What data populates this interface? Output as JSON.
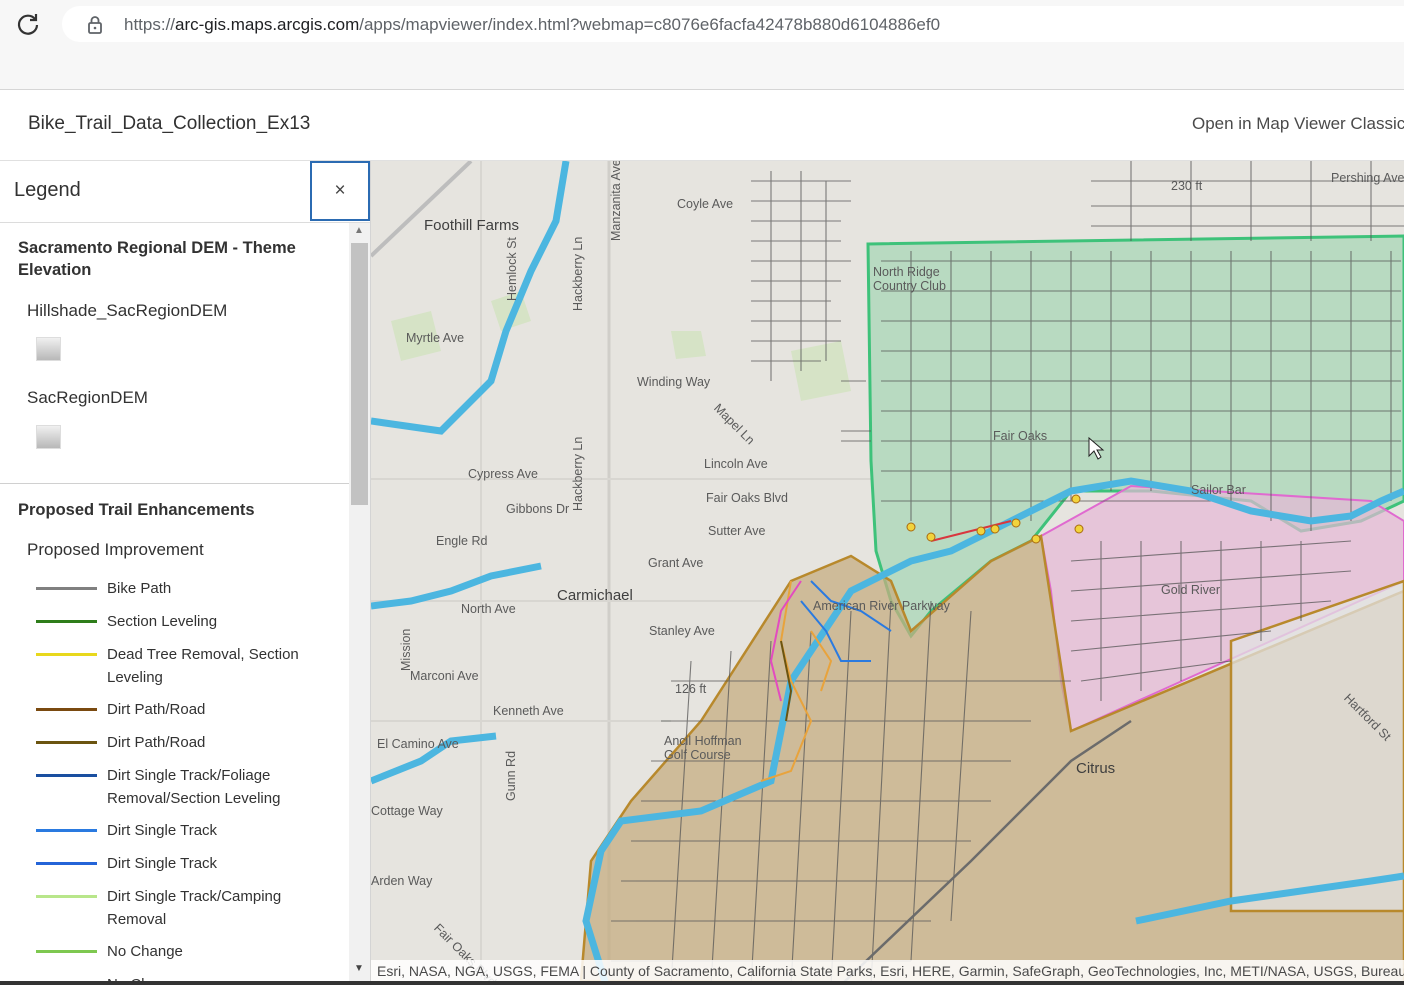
{
  "browser": {
    "url_prefix": "https://",
    "url_host": "arc-gis.maps.arcgis.com",
    "url_path": "/apps/mapviewer/index.html?webmap=c8076e6facfa42478b880d6104886ef0"
  },
  "header": {
    "title": "Bike_Trail_Data_Collection_Ex13",
    "open_classic": "Open in Map Viewer Classic"
  },
  "legend": {
    "title": "Legend",
    "close_label": "×",
    "layers": [
      {
        "title": "Sacramento Regional DEM - Theme Elevation",
        "sublayers": [
          "Hillshade_SacRegionDEM",
          "SacRegionDEM"
        ]
      },
      {
        "title": "Proposed Trail Enhancements",
        "field": "Proposed Improvement",
        "items": [
          {
            "label": "Bike Path",
            "color": "#808080"
          },
          {
            "label": "Section Leveling",
            "color": "#2e7d1a"
          },
          {
            "label": "Dead Tree Removal, Section Leveling",
            "color": "#e8d81c"
          },
          {
            "label": "Dirt Path/Road",
            "color": "#7a4a10"
          },
          {
            "label": "Dirt Path/Road",
            "color": "#6b5410"
          },
          {
            "label": "Dirt Single Track/Foliage Removal/Section Leveling",
            "color": "#1a4fa0"
          },
          {
            "label": "Dirt Single Track",
            "color": "#2a7ae0"
          },
          {
            "label": "Dirt Single Track",
            "color": "#2464d8"
          },
          {
            "label": "Dirt Single Track/Camping Removal",
            "color": "#b8e68a"
          },
          {
            "label": "No Change",
            "color": "#7ec850"
          },
          {
            "label": "No Change",
            "color": "#5fb040"
          }
        ]
      }
    ]
  },
  "map": {
    "labels": [
      "Foothill Farms",
      "Coyle Ave",
      "Manzanita Ave",
      "Hemlock St",
      "Hackberry Ln",
      "Myrtle Ave",
      "Winding Way",
      "Mapel Ln",
      "Lincoln Ave",
      "Fair Oaks Blvd",
      "Cypress Ave",
      "Gibbons Dr",
      "Sutter Ave",
      "Engle Rd",
      "Grant Ave",
      "Carmichael",
      "North Ave",
      "Stanley Ave",
      "Marconi Ave",
      "126 ft",
      "Kenneth Ave",
      "El Camino Ave",
      "Gunn Rd",
      "Ancil Hoffman Golf Course",
      "Cottage Way",
      "Arden Way",
      "Fair Oaks Blvd",
      "Citrus",
      "North Ridge Country Club",
      "Fair Oaks",
      "Sailor Bar",
      "Gold River",
      "Hartford St",
      "Pershing Ave",
      "230 ft",
      "American River Parkway",
      "Mission",
      "Hackberry Ln"
    ],
    "attribution": "Esri, NASA, NGA, USGS, FEMA | County of Sacramento, California State Parks, Esri, HERE, Garmin, SafeGraph, GeoTechnologies, Inc, METI/NASA, USGS, Bureau of Land Management"
  }
}
